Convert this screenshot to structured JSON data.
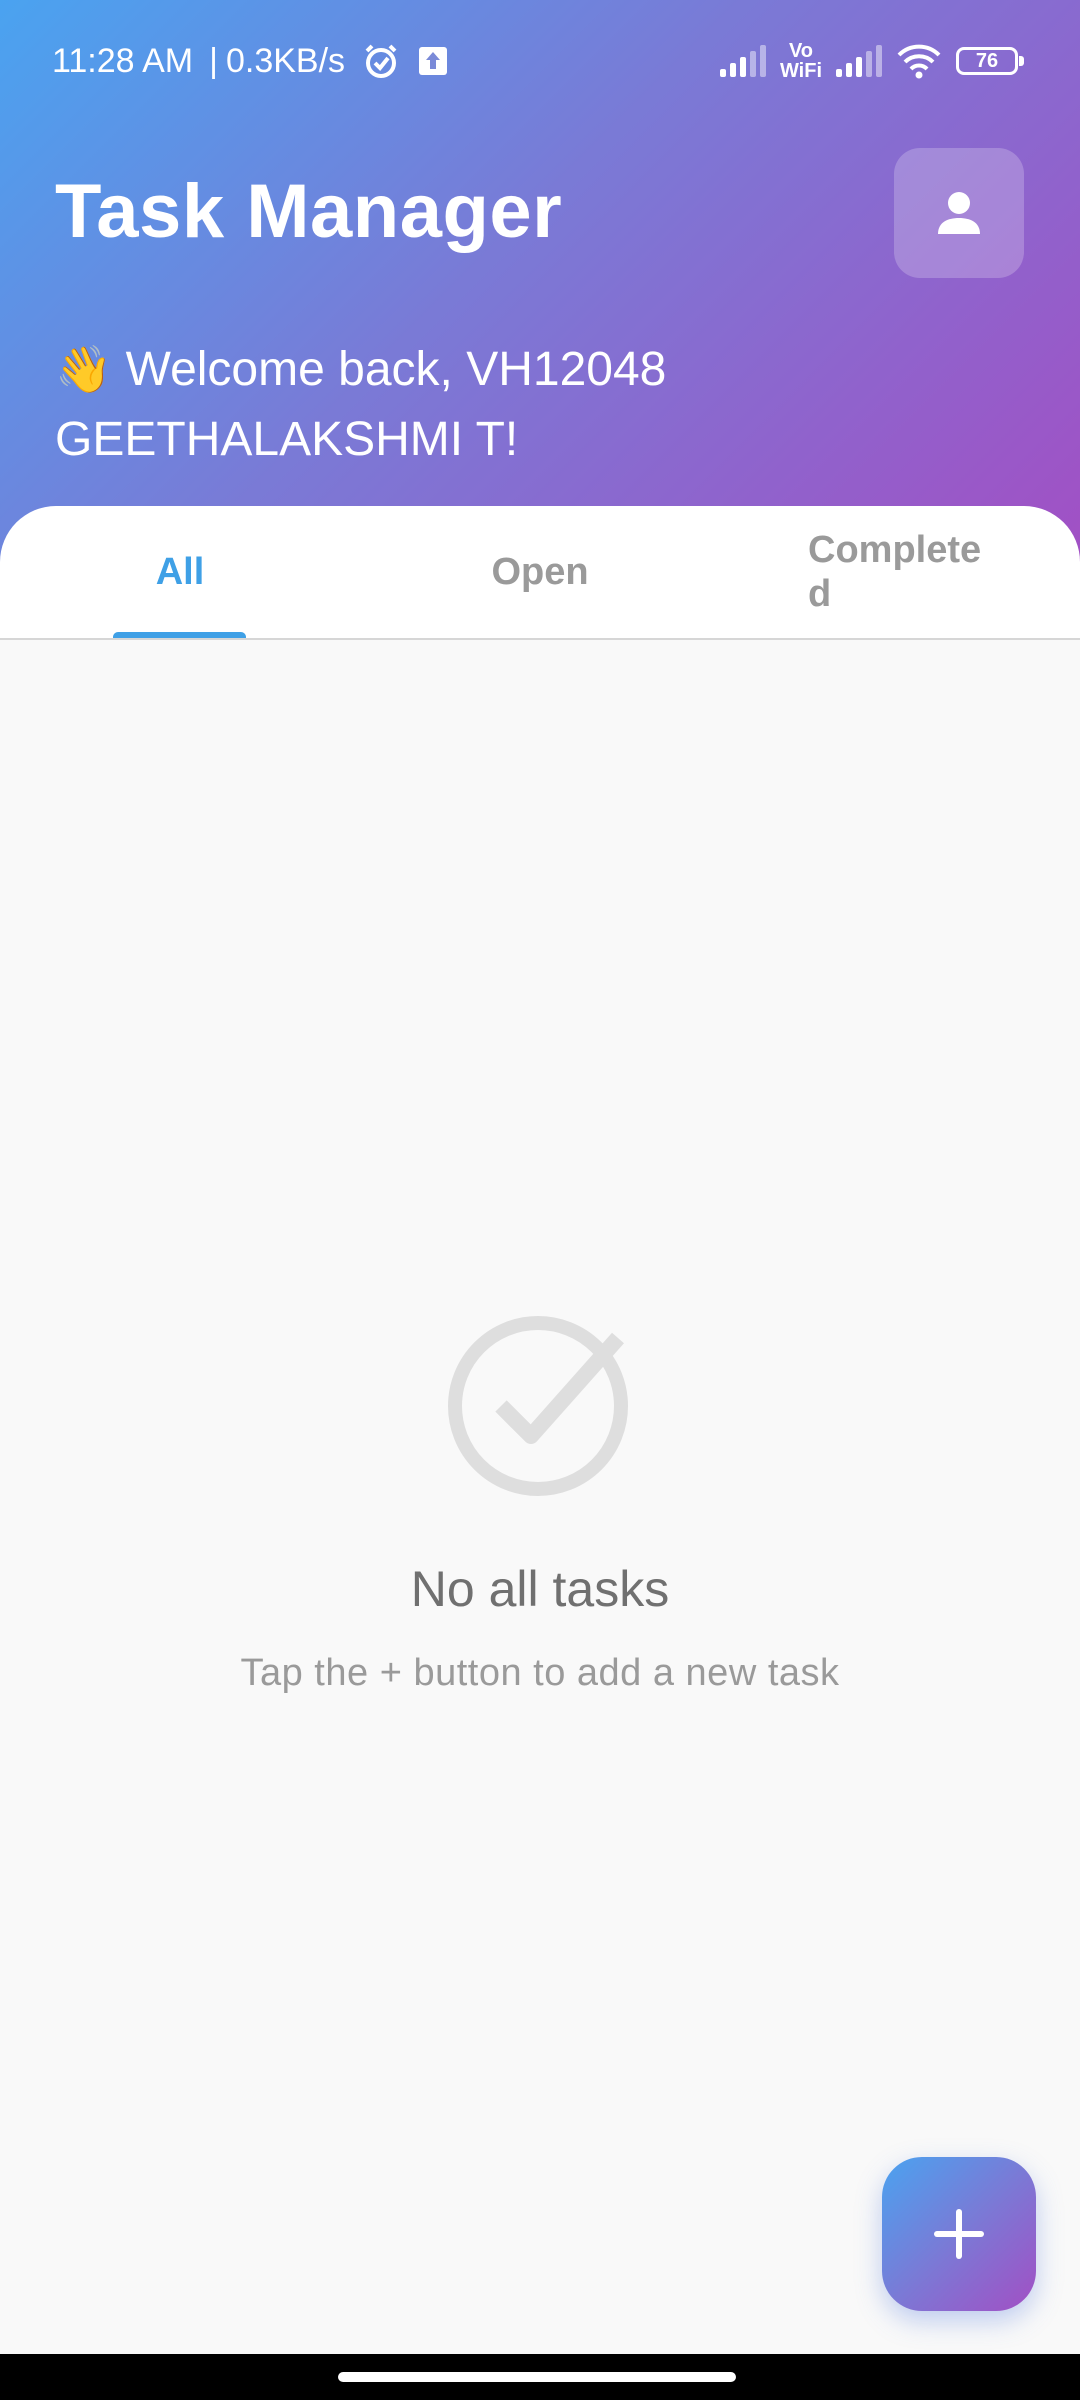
{
  "status_bar": {
    "time": "11:28 AM",
    "separator": "|",
    "net_speed": "0.3KB/s",
    "vowifi_top": "Vo",
    "vowifi_bottom": "WiFi",
    "battery": "76"
  },
  "header": {
    "title": "Task Manager",
    "welcome_emoji": "👋",
    "welcome_text": "Welcome back, VH12048 GEETHALAKSHMI T!"
  },
  "tabs": [
    {
      "label": "All",
      "active": true
    },
    {
      "label": "Open",
      "active": false
    },
    {
      "label": "Completed",
      "active": false
    }
  ],
  "empty_state": {
    "title": "No all tasks",
    "subtitle": "Tap the + button to add a new task"
  },
  "colors": {
    "accent": "#3fa0e6",
    "gradient_start": "#4aa3f0",
    "gradient_end": "#a24fc4"
  },
  "icons": {
    "profile": "person-icon",
    "empty": "check-circle-icon",
    "fab": "plus-icon",
    "alarm": "alarm-icon",
    "upload": "upload-icon",
    "wifi": "wifi-icon"
  }
}
